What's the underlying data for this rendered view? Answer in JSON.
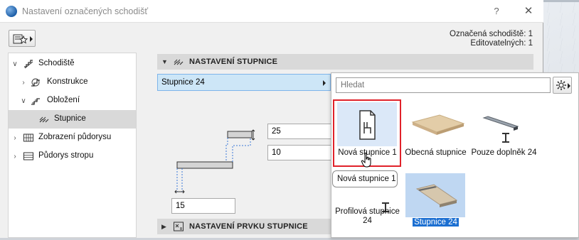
{
  "window": {
    "title": "Nastavení označených schodišť",
    "help_label": "?",
    "close_label": "✕"
  },
  "selection_info": {
    "selected": "Označená schodiště: 1",
    "editable": "Editovatelných: 1"
  },
  "tree": {
    "items": [
      {
        "label": "Schodiště",
        "icon": "stair-icon",
        "expanded": true
      },
      {
        "label": "Konstrukce",
        "icon": "structure-icon",
        "expanded": false
      },
      {
        "label": "Obložení",
        "icon": "finish-icon",
        "expanded": true
      },
      {
        "label": "Stupnice",
        "icon": "tread-icon",
        "selected": true
      },
      {
        "label": "Zobrazení půdorysu",
        "icon": "floorplan-display-icon",
        "expanded": false
      },
      {
        "label": "Půdorys stropu",
        "icon": "ceiling-plan-icon",
        "expanded": false
      }
    ]
  },
  "sections": {
    "tread_settings": "NASTAVENÍ STUPNICE",
    "tread_component_settings": "NASTAVENÍ PRVKU STUPNICE"
  },
  "tread_select": {
    "value": "Stupnice 24"
  },
  "inputs": {
    "nosing": "25",
    "thickness": "10",
    "offset": "15"
  },
  "popup": {
    "search_placeholder": "Hledat",
    "tiles": [
      {
        "label": "Nová stupnice 1",
        "state": "active"
      },
      {
        "label": "Obecná stupnice",
        "state": "normal"
      },
      {
        "label": "Pouze doplněk 24",
        "state": "normal"
      },
      {
        "label": "Profilová stupnice 24",
        "state": "normal"
      },
      {
        "label": "Stupnice 24",
        "state": "selected"
      }
    ],
    "tooltip": "Nová stupnice 1"
  },
  "colors": {
    "accent_blue": "#1c6fd1",
    "highlight_red": "#e0222a",
    "select_bg": "#cde6f7"
  }
}
